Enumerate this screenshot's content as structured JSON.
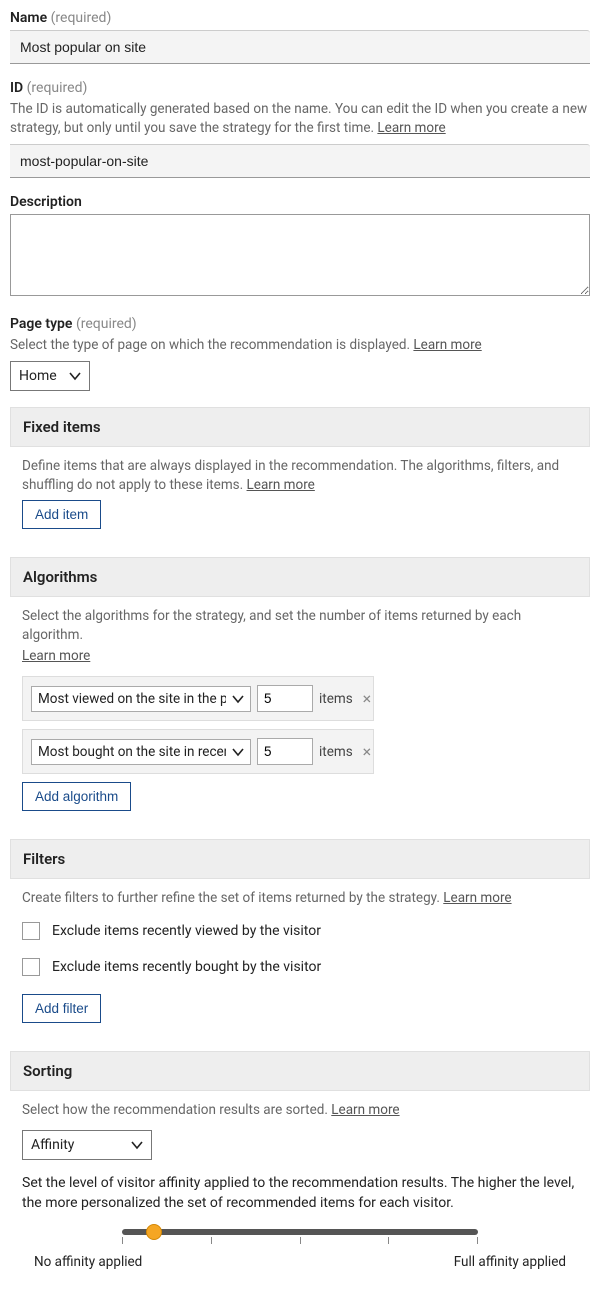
{
  "name": {
    "label": "Name",
    "required": "(required)",
    "value": "Most popular on site"
  },
  "id": {
    "label": "ID",
    "required": "(required)",
    "help": "The ID is automatically generated based on the name. You can edit the ID when you create a new strategy, but only until you save the strategy for the first time. ",
    "learn": "Learn more",
    "value": "most-popular-on-site"
  },
  "description": {
    "label": "Description",
    "value": ""
  },
  "pageType": {
    "label": "Page type",
    "required": "(required)",
    "help": "Select the type of page on which the recommendation is displayed. ",
    "learn": "Learn more",
    "value": "Home"
  },
  "fixedItems": {
    "title": "Fixed items",
    "help": "Define items that are always displayed in the recommendation. The algorithms, filters, and shuffling do not apply to these items. ",
    "learn": "Learn more",
    "addBtn": "Add item"
  },
  "algorithms": {
    "title": "Algorithms",
    "help": "Select the algorithms for the strategy, and set the number of items returned by each algorithm. ",
    "learn": "Learn more",
    "rows": [
      {
        "name": "Most viewed on the site in the pa",
        "count": "5"
      },
      {
        "name": "Most bought on the site in recent",
        "count": "5"
      }
    ],
    "itemsLabel": "items",
    "addBtn": "Add algorithm"
  },
  "filters": {
    "title": "Filters",
    "help": "Create filters to further refine the set of items returned by the strategy. ",
    "learn": "Learn more",
    "opts": [
      "Exclude items recently viewed by the visitor",
      "Exclude items recently bought by the visitor"
    ],
    "addBtn": "Add filter"
  },
  "sorting": {
    "title": "Sorting",
    "help": "Select how the recommendation results are sorted. ",
    "learn": "Learn more",
    "value": "Affinity",
    "affinityHelp": "Set the level of visitor affinity applied to the recommendation results. The higher the level, the more personalized the set of recommended items for each visitor.",
    "leftLabel": "No affinity applied",
    "rightLabel": "Full affinity applied"
  }
}
